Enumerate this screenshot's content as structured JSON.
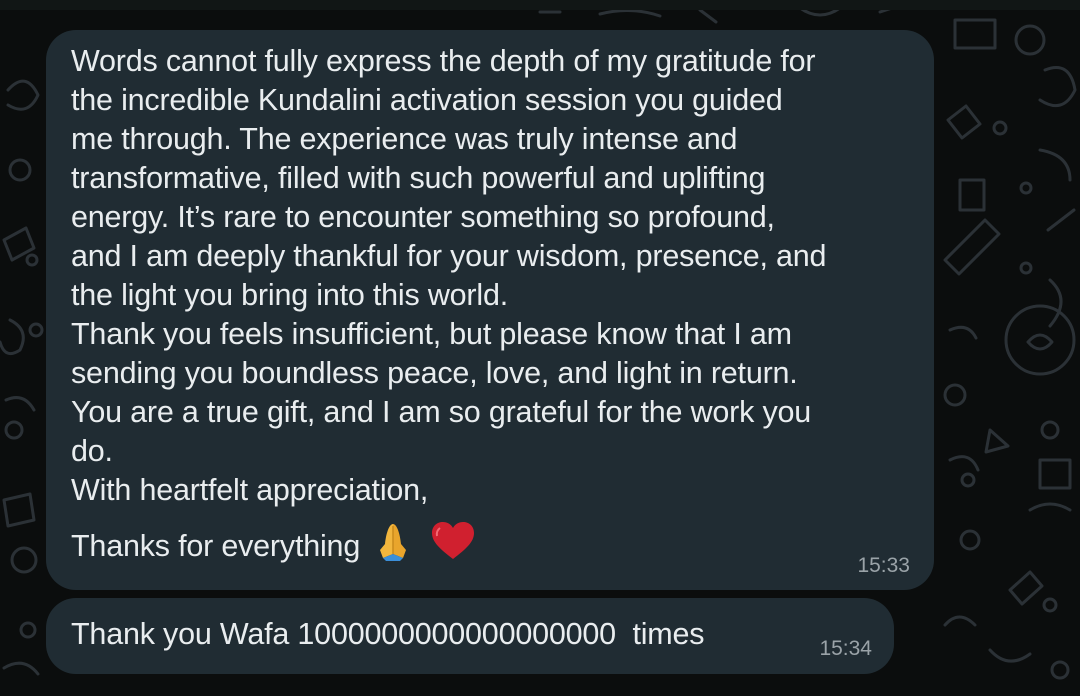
{
  "messages": [
    {
      "text": "Words cannot fully express the depth of my gratitude for\nthe incredible Kundalini activation session you guided\nme through. The experience was truly intense and\ntransformative, filled with such powerful and uplifting\nenergy. It’s rare to encounter something so profound,\nand I am deeply thankful for your wisdom, presence, and\nthe light you bring into this world.\nThank you feels insufficient, but please know that I am\nsending you boundless peace, love, and light in return.\nYou are a true gift, and I am so grateful for the work you\ndo.\nWith heartfelt appreciation,",
      "last_line": "Thanks for everything",
      "emojis": [
        "folded-hands-icon",
        "heart-icon"
      ],
      "time": "15:33"
    },
    {
      "text": "Thank you Wafa 1000000000000000000  times",
      "time": "15:34"
    }
  ],
  "colors": {
    "background": "#0b0d0d",
    "bubble": "#202c33",
    "text": "#e9edef",
    "timestamp": "#9aa3a8",
    "doodle": "#2a3034"
  }
}
